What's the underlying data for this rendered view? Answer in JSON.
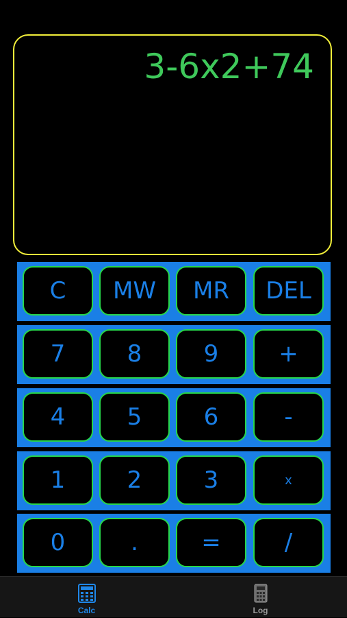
{
  "display": {
    "expression": "3-6x2+74"
  },
  "keypad": {
    "rows": [
      [
        "C",
        "MW",
        "MR",
        "DEL"
      ],
      [
        "7",
        "8",
        "9",
        "+"
      ],
      [
        "4",
        "5",
        "6",
        "-"
      ],
      [
        "1",
        "2",
        "3",
        "x"
      ],
      [
        "0",
        ".",
        "=",
        "/"
      ]
    ]
  },
  "tabbar": {
    "calc_label": "Calc",
    "log_label": "Log",
    "calc_icon": "calculator-icon",
    "log_icon": "log-icon",
    "active_tab": "Calc"
  },
  "colors": {
    "display_border": "#f2ef3a",
    "display_text": "#3fc95b",
    "keypad_background": "#1a7fe6",
    "key_border": "#27d64a",
    "key_text": "#1a7fe6",
    "active_tab": "#1f87e8",
    "inactive_tab": "#9a9a9a"
  }
}
